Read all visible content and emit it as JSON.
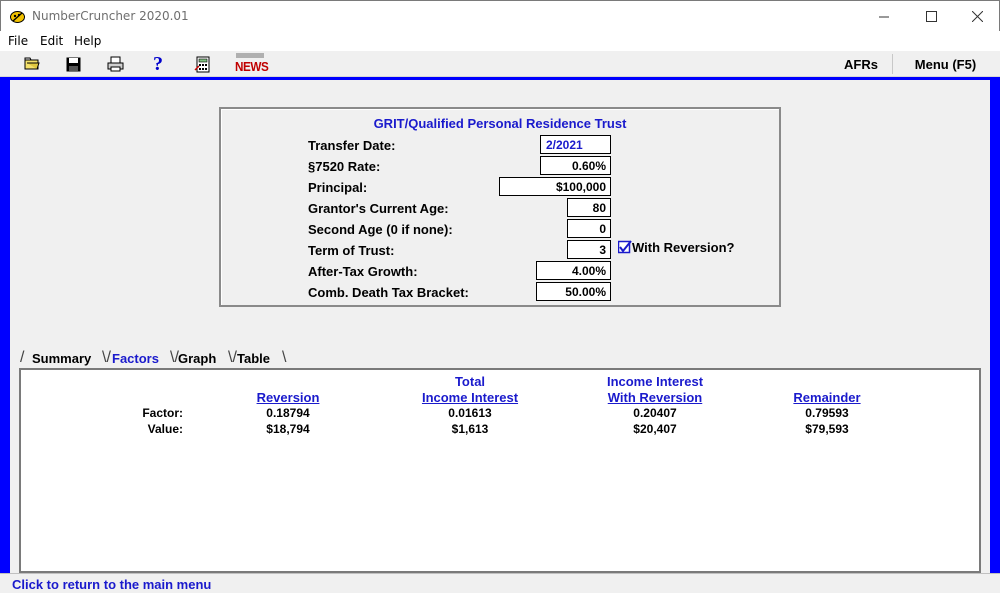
{
  "window": {
    "title": "NumberCruncher 2020.01"
  },
  "menu": {
    "items": [
      "File",
      "Edit",
      "Help"
    ]
  },
  "toolbar": {
    "icons": [
      "open-folder-icon",
      "save-icon",
      "print-icon",
      "help-icon",
      "calculator-icon",
      "news-icon"
    ],
    "news_label": "NEWS",
    "afrs_label": "AFRs",
    "menu_label": "Menu (F5)"
  },
  "form": {
    "title": "GRIT/Qualified Personal Residence Trust",
    "fields": [
      {
        "label": "Transfer Date:",
        "value": "2/2021"
      },
      {
        "label": "§7520 Rate:",
        "value": "0.60%"
      },
      {
        "label": "Principal:",
        "value": "$100,000"
      },
      {
        "label": "Grantor's Current Age:",
        "value": "80"
      },
      {
        "label": "Second Age (0 if none):",
        "value": "0"
      },
      {
        "label": "Term of Trust:",
        "value": "3"
      },
      {
        "label": "After-Tax Growth:",
        "value": "4.00%"
      },
      {
        "label": "Comb. Death Tax Bracket:",
        "value": "50.00%"
      }
    ],
    "reversion_checkbox": {
      "label": "With Reversion?",
      "checked": true
    }
  },
  "tabs": [
    {
      "label": "Summary",
      "active": false
    },
    {
      "label": "Factors",
      "active": true
    },
    {
      "label": "Graph",
      "active": false
    },
    {
      "label": "Table",
      "active": false
    }
  ],
  "results": {
    "columns": [
      {
        "line1": "",
        "line2": "Reversion"
      },
      {
        "line1": "Total",
        "line2": "Income Interest"
      },
      {
        "line1": "Income Interest",
        "line2": "With Reversion"
      },
      {
        "line1": "",
        "line2": "Remainder"
      }
    ],
    "rows": [
      {
        "label": "Factor:",
        "values": [
          "0.18794",
          "0.01613",
          "0.20407",
          "0.79593"
        ]
      },
      {
        "label": "Value:",
        "values": [
          "$18,794",
          "$1,613",
          "$20,407",
          "$79,593"
        ]
      }
    ]
  },
  "status": {
    "text": "Click to return to the main menu"
  },
  "colors": {
    "frame": "#0000ff",
    "accent_text": "#1a1acc",
    "news": "#c00000"
  }
}
